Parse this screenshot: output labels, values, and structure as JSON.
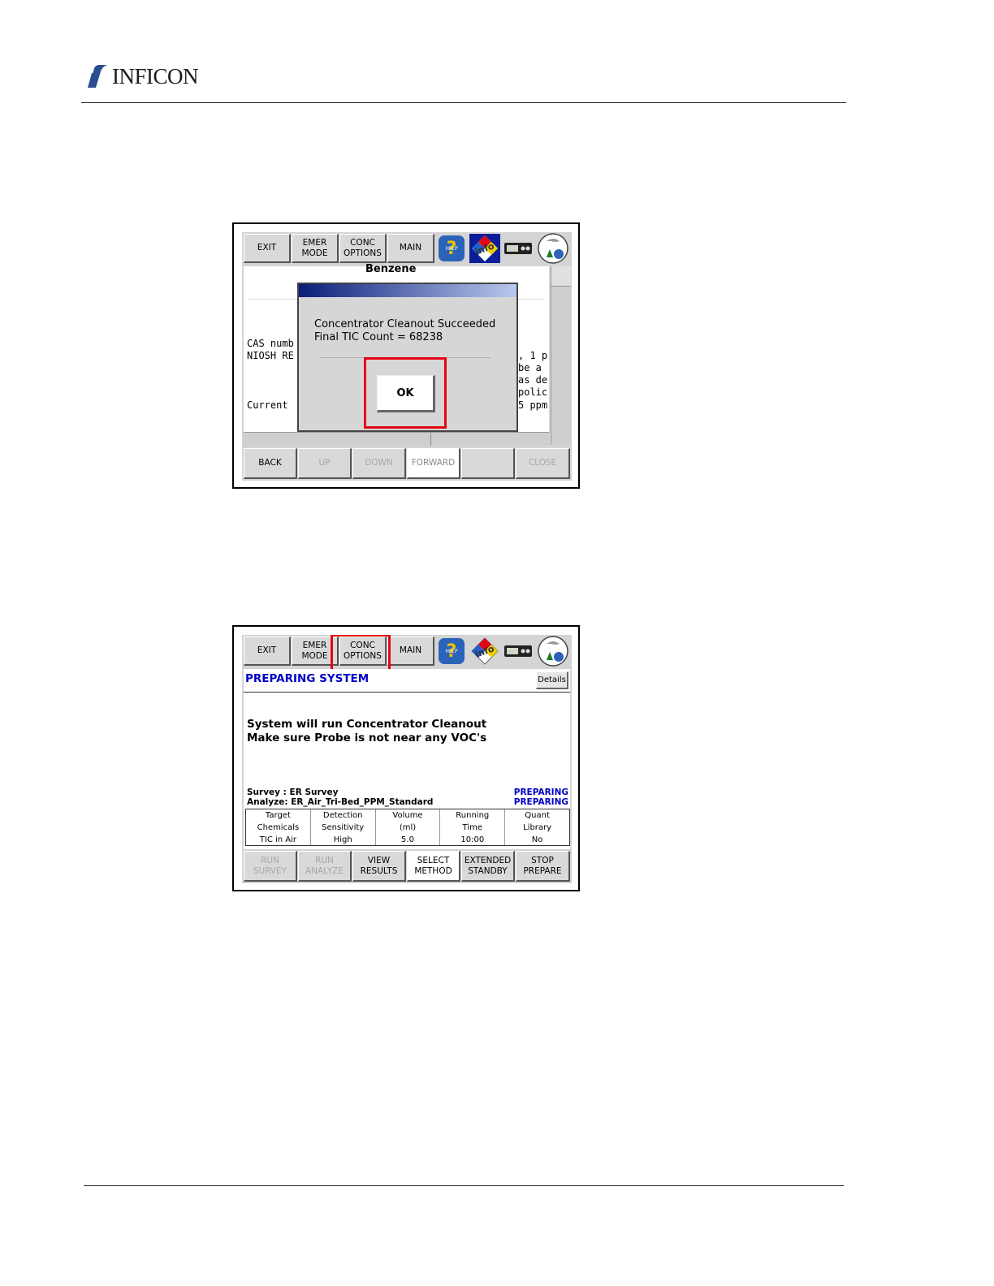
{
  "header": {
    "brand": "INFICON"
  },
  "screen1": {
    "toolbar": {
      "exit": "EXIT",
      "emer_mode": "EMER\nMODE",
      "conc_options": "CONC\nOPTIONS",
      "main": "MAIN"
    },
    "toolbar_icons": [
      "help-icon",
      "info-hazard-icon",
      "instrument-icon",
      "environment-icon"
    ],
    "background_text": {
      "heading": "Benzene",
      "cas": "CAS numb",
      "niosh": "NIOSH RE",
      "current": "Current",
      "right_lines": [
        ", 1 p",
        "be a",
        "as de",
        "polic",
        "5 ppm"
      ]
    },
    "dialog": {
      "line1": "Concentrator Cleanout Succeeded",
      "line2": "Final TIC Count = 68238",
      "ok": "OK"
    },
    "bottom": {
      "back": "BACK",
      "up": "UP",
      "down": "DOWN",
      "forward": "FORWARD",
      "blank": "",
      "close": "CLOSE"
    }
  },
  "screen2": {
    "toolbar": {
      "exit": "EXIT",
      "emer_mode": "EMER\nMODE",
      "conc_options": "CONC\nOPTIONS",
      "main": "MAIN"
    },
    "status_title": "PREPARING SYSTEM",
    "details": "Details",
    "message": {
      "line1": "System will run Concentrator Cleanout",
      "line2": "Make sure Probe is not near any VOC's"
    },
    "survey_label": "Survey : ER Survey",
    "analyze_label": "Analyze: ER_Air_Tri-Bed_PPM_Standard",
    "survey_state": "PREPARING",
    "analyze_state": "PREPARING",
    "table": [
      {
        "h1": "Target",
        "h2": "Chemicals",
        "v": "TIC in Air"
      },
      {
        "h1": "Detection",
        "h2": "Sensitivity",
        "v": "High"
      },
      {
        "h1": "Volume",
        "h2": "(ml)",
        "v": "5.0"
      },
      {
        "h1": "Running",
        "h2": "Time",
        "v": "10:00"
      },
      {
        "h1": "Quant",
        "h2": "Library",
        "v": "No"
      }
    ],
    "bottom": {
      "run_survey": "RUN\nSURVEY",
      "run_analyze": "RUN\nANALYZE",
      "view_results": "VIEW\nRESULTS",
      "select_method": "SELECT\nMETHOD",
      "extended_standby": "EXTENDED\nSTANDBY",
      "stop_prepare": "STOP\nPREPARE"
    }
  },
  "colors": {
    "highlight": "#e30613",
    "status_blue": "#0000c8",
    "dialog_title": "#0a1e7a"
  }
}
